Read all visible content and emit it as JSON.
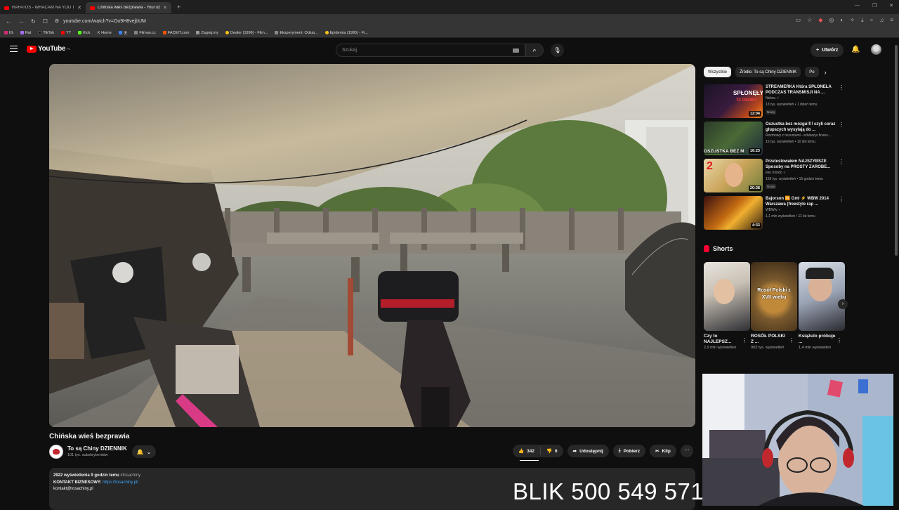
{
  "browser": {
    "tabs": [
      {
        "label": "RAFATUS - WRACAM NA YOU TUBE",
        "active": false
      },
      {
        "label": "Chińska wieś bezprawia - YouTube",
        "active": true
      }
    ],
    "url": "youtube.com/watch?v=Oo9H8vejbUM",
    "bookmarks": [
      "IG",
      "Rat",
      "TikTok",
      "YT",
      "Kick",
      "Home",
      "天",
      "Filman.cc",
      "FACEIT.com",
      "Zagraj.my",
      "Dealer (1996) - Film...",
      "Eksperyment: Odsia...",
      "Epidemia (1995) - Fi..."
    ]
  },
  "header": {
    "logo_text": "YouTube",
    "logo_region": "PL",
    "search_placeholder": "Szukaj",
    "create_label": "Utwórz"
  },
  "video": {
    "title": "Chińska wieś bezprawia",
    "channel": "To są Chiny DZIENNIK",
    "subscribers": "101 tys. subskrybentów",
    "likes": "342",
    "dislikes": "6",
    "share_label": "Udostępnij",
    "download_label": "Pobierz",
    "clip_label": "Klip",
    "more_label": "···"
  },
  "description": {
    "stats": "2922 wyświetlenia  9 godzin temu",
    "hashtag": "#tosachiny",
    "line2_label": "KONTAKT BIZNESOWY:",
    "line2_link": "https://tosachiny.pl/",
    "line3": "kontakt@tosachiny.pl"
  },
  "filters": {
    "chips": [
      "Wszystkie",
      "Źródło: To są Chiny DZIENNIK",
      "Po"
    ]
  },
  "recommendations": [
    {
      "title": "STREAMERKA Która SPŁONEŁA PODCZAS TRANSMISJI NA ...",
      "channel": "Neksu ✓",
      "meta": "13 tys. wyświetleń • 1 dzień temu",
      "badge": "Nowy",
      "duration": "12:04",
      "thumb_text": "SPŁONĘŁY"
    },
    {
      "title": "Oszustka bez mózgu!!!! czyli coraz głupszych wysyłają do ...",
      "channel": "Rozmowy z oszustami - edukacja finans...",
      "meta": "15 tys. wyświetleń • 10 dni temu",
      "badge": "",
      "duration": "16:23",
      "thumb_text": "OSZUSTKA BEZ M"
    },
    {
      "title": "Przetestowałem NAJSZYBSZE Sposoby na PROSTY ZAROBE...",
      "channel": "eko mordo ✓",
      "meta": "159 tys. wyświetleń • 15 godzin temu",
      "badge": "Nowy",
      "duration": "20:38",
      "thumb_text": "2"
    },
    {
      "title": "Bajorson 🆚 Gml ⚡ WBW 2014 Warszawa (freestyle rap ...",
      "channel": "WBWtv ✓",
      "meta": "1,1 mln wyświetleń • 11 lat temu",
      "badge": "",
      "duration": "4:33",
      "thumb_text": ""
    }
  ],
  "shorts": {
    "heading": "Shorts",
    "items": [
      {
        "title": "Czy to NAJLEPSZ...",
        "views": "2,9 mln wyświetleń",
        "thumb_text": ""
      },
      {
        "title": "ROSÓŁ POLSKI Z ...",
        "views": "903 tys. wyświetleń",
        "thumb_text": "Rosół Polski z XVII wieku"
      },
      {
        "title": "Książulo próbuje ...",
        "views": "1,4 mln wyświetleń",
        "thumb_text": ""
      }
    ]
  },
  "overlay": {
    "blik_text": "BLIK 500 549 571"
  }
}
